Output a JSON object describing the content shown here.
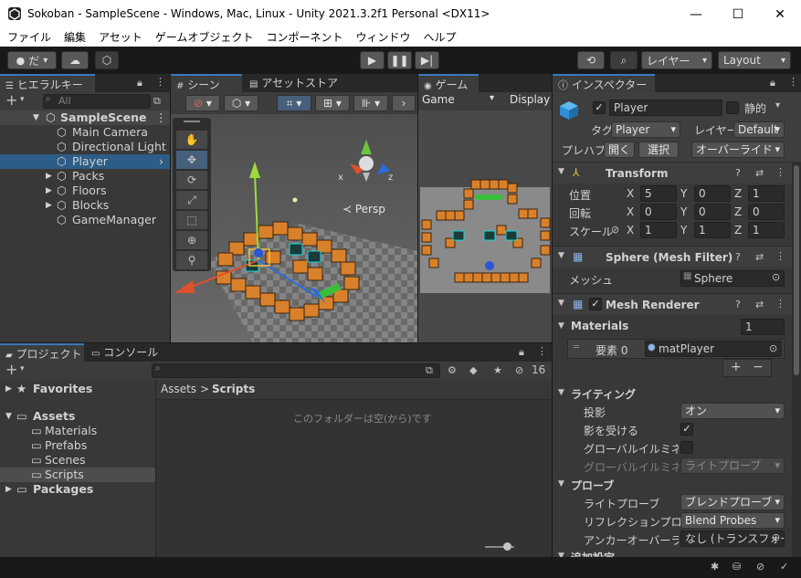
{
  "window": {
    "title": "Sokoban - SampleScene - Windows, Mac, Linux - Unity 2021.3.2f1 Personal <DX11>",
    "minimize": "—",
    "maximize": "☐",
    "close": "✕"
  },
  "menu": [
    "ファイル",
    "編集",
    "アセット",
    "ゲームオブジェクト",
    "コンポーネント",
    "ウィンドウ",
    "ヘルプ"
  ],
  "toolbar": {
    "account": "だ",
    "layers": "レイヤー",
    "layout": "Layout"
  },
  "hierarchy": {
    "tab": "ヒエラルキー",
    "add": "+",
    "search_placeholder": "All",
    "scene": "SampleScene",
    "items": [
      {
        "label": "Main Camera",
        "expandable": false,
        "selected": false
      },
      {
        "label": "Directional Light",
        "expandable": false,
        "selected": false
      },
      {
        "label": "Player",
        "expandable": false,
        "selected": true
      },
      {
        "label": "Packs",
        "expandable": true,
        "selected": false
      },
      {
        "label": "Floors",
        "expandable": true,
        "selected": false
      },
      {
        "label": "Blocks",
        "expandable": true,
        "selected": false
      },
      {
        "label": "GameManager",
        "expandable": false,
        "selected": false
      }
    ]
  },
  "scene": {
    "tab": "シーン",
    "tab2": "アセットストア",
    "persp": "≺ Persp",
    "axis_x": "x",
    "axis_z": "z"
  },
  "game": {
    "tab": "ゲーム",
    "view": "Game",
    "display": "Display"
  },
  "project": {
    "tab": "プロジェクト",
    "tab2": "コンソール",
    "add": "+",
    "count": "16",
    "tree": [
      {
        "label": "Favorites",
        "bold": true
      },
      {
        "label": "Assets",
        "bold": true
      },
      {
        "label": "Materials",
        "bold": false
      },
      {
        "label": "Prefabs",
        "bold": false
      },
      {
        "label": "Scenes",
        "bold": false
      },
      {
        "label": "Scripts",
        "bold": false
      },
      {
        "label": "Packages",
        "bold": true
      }
    ],
    "breadcrumb_root": "Assets",
    "breadcrumb_sep": ">",
    "breadcrumb_current": "Scripts",
    "empty_message": "このフォルダーは空(から)です"
  },
  "inspector": {
    "tab": "インスペクター",
    "name": "Player",
    "static_label": "静的",
    "tag_label": "タグ",
    "tag_value": "Player",
    "layer_label": "レイヤー",
    "layer_value": "Default",
    "prefab_label": "プレハブ",
    "open_button": "開く",
    "select_button": "選択",
    "overrides": "オーバーライド",
    "transform": {
      "title": "Transform",
      "position_label": "位置",
      "rotation_label": "回転",
      "scale_label": "スケール",
      "x": "X",
      "y": "Y",
      "z": "Z",
      "position": [
        "5",
        "0",
        "1"
      ],
      "rotation": [
        "0",
        "0",
        "0"
      ],
      "scale": [
        "1",
        "1",
        "1"
      ]
    },
    "mesh_filter": {
      "title": "Sphere (Mesh Filter)",
      "mesh_label": "メッシュ",
      "mesh_value": "Sphere"
    },
    "mesh_renderer": {
      "title": "Mesh Renderer",
      "materials_label": "Materials",
      "materials_count": "1",
      "element_label": "要素 0",
      "element_value": "matPlayer",
      "add": "+",
      "remove": "−",
      "lighting_label": "ライティング",
      "cast_shadows_label": "投影",
      "cast_shadows_value": "オン",
      "receive_shadows_label": "影を受ける",
      "gi_label": "グローバルイルミネーション",
      "gi_label2": "グローバルイルミネーション",
      "gi_value": "ライトプローブ",
      "probes_label": "プローブ",
      "light_probes_label": "ライトプローブ",
      "light_probes_value": "ブレンドプローブ",
      "reflection_label": "リフレクションプローブ",
      "reflection_value": "Blend Probes",
      "anchor_label": "アンカーオーバーライド",
      "anchor_value": "なし (トランスフォーム)",
      "additional_label": "追加設定"
    }
  },
  "colors": {
    "accent": "#3a79bb",
    "selection": "#2c5d87",
    "panel": "#383838",
    "block": "#d9812a",
    "goal": "#3bbf3b",
    "player": "#2b56d6"
  }
}
